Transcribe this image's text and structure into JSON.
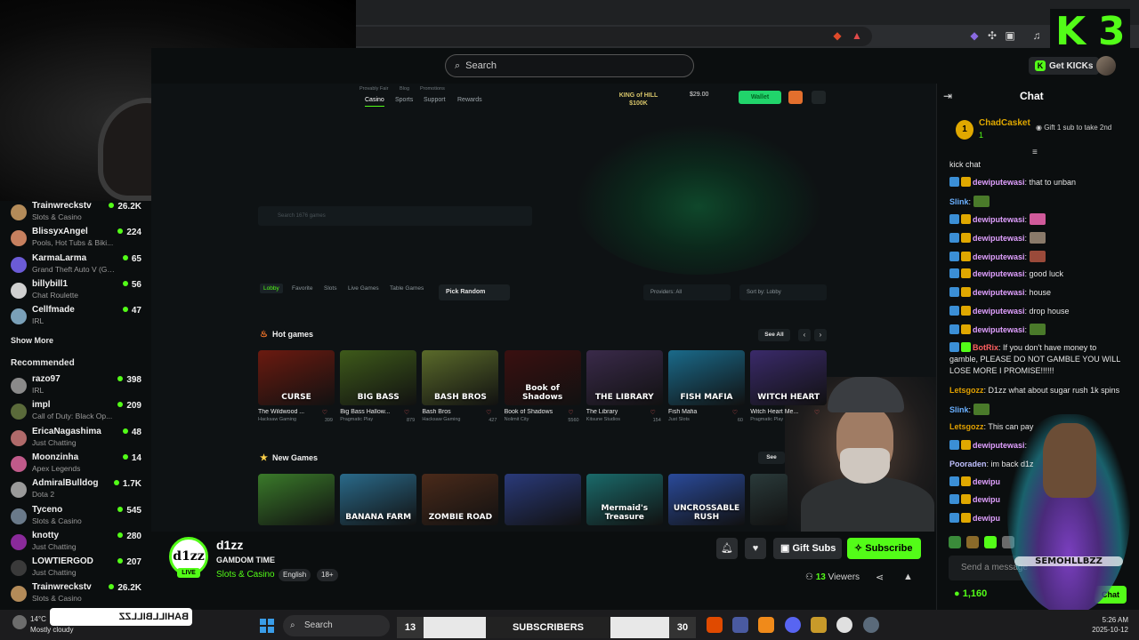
{
  "browser": {
    "search_placeholder": "Search",
    "get_kicks_label": "Get KICKs"
  },
  "overlay": {
    "logo": "K3"
  },
  "sidebar": {
    "following": [
      {
        "name": "Trainwreckstv",
        "category": "Slots & Casino",
        "viewers": "26.2K",
        "color": "#b38b59"
      },
      {
        "name": "BlissyxAngel",
        "category": "Pools, Hot Tubs & Biki...",
        "viewers": "224",
        "color": "#c7805f"
      },
      {
        "name": "KarmaLarma",
        "category": "Grand Theft Auto V (GTA)",
        "viewers": "65",
        "color": "#6b5bd6"
      },
      {
        "name": "billybill1",
        "category": "Chat Roulette",
        "viewers": "56",
        "color": "#d0d0d0"
      },
      {
        "name": "Cellfmade",
        "category": "IRL",
        "viewers": "47",
        "color": "#7aa0b8"
      }
    ],
    "show_more": "Show More",
    "recommended_title": "Recommended",
    "recommended": [
      {
        "name": "razo97",
        "category": "IRL",
        "viewers": "398",
        "color": "#8a8a8a"
      },
      {
        "name": "impl",
        "category": "Call of Duty: Black Op...",
        "viewers": "209",
        "color": "#5a6a3a"
      },
      {
        "name": "EricaNagashima",
        "category": "Just Chatting",
        "viewers": "48",
        "color": "#b06a6a"
      },
      {
        "name": "Moonzinha",
        "category": "Apex Legends",
        "viewers": "14",
        "color": "#c05a8a"
      },
      {
        "name": "AdmiralBulldog",
        "category": "Dota 2",
        "viewers": "1.7K",
        "color": "#9a9a9a"
      },
      {
        "name": "Tyceno",
        "category": "Slots & Casino",
        "viewers": "545",
        "color": "#6a7a8a"
      },
      {
        "name": "knotty",
        "category": "Just Chatting",
        "viewers": "280",
        "color": "#8a2a9a"
      },
      {
        "name": "LOWTIERGOD",
        "category": "Just Chatting",
        "viewers": "207",
        "color": "#3a3a3a"
      },
      {
        "name": "Trainwreckstv",
        "category": "Slots & Casino",
        "viewers": "26.2K",
        "color": "#b38b59"
      }
    ]
  },
  "gamdom": {
    "nav_small": [
      "Provably Fair",
      "Blog",
      "Promotions"
    ],
    "nav": [
      "Casino",
      "Sports",
      "Support",
      "Rewards"
    ],
    "king_hill": "KING of HILL",
    "king_prize": "$100K",
    "balance": "$29.00",
    "wallet": "Wallet",
    "game_search_placeholder": "Search 1676 games",
    "tabs": [
      "Lobby",
      "Favorite",
      "Slots",
      "Live Games",
      "Table Games"
    ],
    "pick_random": "Pick Random",
    "providers": "Providers: All",
    "sort_by": "Sort by: Lobby",
    "hot_games_title": "Hot games",
    "see_all": "See All",
    "new_games_title": "New Games",
    "see": "See",
    "hot_games": [
      {
        "title": "The Wildwood ...",
        "provider": "Hacksaw Gaming",
        "count": "399",
        "art": "CURSE",
        "bg": "#6b1a10"
      },
      {
        "title": "Big Bass Hallow...",
        "provider": "Pragmatic Play",
        "count": "879",
        "art": "BIG BASS",
        "bg": "#3e5a1a"
      },
      {
        "title": "Bash Bros",
        "provider": "Hacksaw Gaming",
        "count": "427",
        "art": "BASH BROS",
        "bg": "#5a6a2a"
      },
      {
        "title": "Book of Shadows",
        "provider": "Nolimit City",
        "count": "5560",
        "art": "Book of Shadows",
        "bg": "#3a1010"
      },
      {
        "title": "The Library",
        "provider": "Kitsune Studios",
        "count": "154",
        "art": "THE LIBRARY",
        "bg": "#3a2a4a"
      },
      {
        "title": "Fish Mafia",
        "provider": "Just Slots",
        "count": "60",
        "art": "FISH MAFIA",
        "bg": "#1a6a8a"
      },
      {
        "title": "Witch Heart Me...",
        "provider": "Pragmatic Play",
        "count": "",
        "art": "WITCH HEART",
        "bg": "#3a2a6a"
      }
    ],
    "new_games": [
      {
        "art": "",
        "bg": "#3a7a2a"
      },
      {
        "art": "BANANA FARM",
        "bg": "#2a6a8a"
      },
      {
        "art": "ZOMBIE ROAD",
        "bg": "#4a2a1a"
      },
      {
        "art": "",
        "bg": "#2a3a7a"
      },
      {
        "art": "Mermaid's Treasure",
        "bg": "#1a6a6a"
      },
      {
        "art": "UNCROSSABLE RUSH",
        "bg": "#2a4a9a"
      },
      {
        "art": "",
        "bg": "#2a3a3a"
      }
    ]
  },
  "stream": {
    "avatar_text": "d1zz",
    "live": "LIVE",
    "name": "d1zz",
    "title": "GAMDOM TIME",
    "category": "Slots & Casino",
    "tags": [
      "English",
      "18+"
    ],
    "gift_subs": "Gift Subs",
    "subscribe": "Subscribe",
    "viewers_count": "13",
    "viewers_label": "Viewers"
  },
  "chat": {
    "title": "Chat",
    "pinned": {
      "rank": "1",
      "user": "ChadCasket",
      "sub": "1",
      "gift_text": "Gift 1 sub to take 2nd"
    },
    "messages": [
      {
        "user": "",
        "text": "kick chat",
        "color": "#e6e6e6",
        "badges": []
      },
      {
        "user": "dewiputewasi",
        "text": ": that to unban",
        "color": "#e0a0ff",
        "badges": [
          "b1",
          "b2"
        ]
      },
      {
        "user": "Slink",
        "text": ":",
        "color": "#6ab0ff",
        "badges": [],
        "emote": "#4a7a2a"
      },
      {
        "user": "dewiputewasi",
        "text": ":",
        "color": "#e0a0ff",
        "badges": [
          "b1",
          "b2"
        ],
        "emote": "#d05a9a"
      },
      {
        "user": "dewiputewasi",
        "text": ":",
        "color": "#e0a0ff",
        "badges": [
          "b1",
          "b2"
        ],
        "emote": "#8a7a6a"
      },
      {
        "user": "dewiputewasi",
        "text": ":",
        "color": "#e0a0ff",
        "badges": [
          "b1",
          "b2"
        ],
        "emote": "#9a4a3a"
      },
      {
        "user": "dewiputewasi",
        "text": ": good luck",
        "color": "#e0a0ff",
        "badges": [
          "b1",
          "b2"
        ]
      },
      {
        "user": "dewiputewasi",
        "text": ": house",
        "color": "#e0a0ff",
        "badges": [
          "b1",
          "b2"
        ]
      },
      {
        "user": "dewiputewasi",
        "text": ": drop house",
        "color": "#e0a0ff",
        "badges": [
          "b1",
          "b2"
        ]
      },
      {
        "user": "dewiputewasi",
        "text": ":",
        "color": "#e0a0ff",
        "badges": [
          "b1",
          "b2"
        ],
        "emote": "#4a7a2a"
      },
      {
        "user": "BotRix",
        "text": ": If you don't have money to gamble, PLEASE DO NOT GAMBLE YOU WILL LOSE MORE I PROMISE!!!!!!",
        "color": "#ff6060",
        "badges": [
          "b1",
          "b3"
        ]
      },
      {
        "user": "Letsgozz",
        "text": ": D1zz what about sugar rush 1k spins",
        "color": "#e0a000",
        "badges": []
      },
      {
        "user": "Slink",
        "text": ":",
        "color": "#6ab0ff",
        "badges": [],
        "emote": "#4a7a2a"
      },
      {
        "user": "Letsgozz",
        "text": ": This can pay",
        "color": "#e0a000",
        "badges": []
      },
      {
        "user": "dewiputewasi",
        "text": ":",
        "color": "#e0a0ff",
        "badges": [
          "b1",
          "b2"
        ]
      },
      {
        "user": "Pooraden",
        "text": ": im back d1z",
        "color": "#c0c0ff",
        "badges": []
      },
      {
        "user": "dewipu",
        "text": "",
        "color": "#e0a0ff",
        "badges": [
          "b1",
          "b2"
        ]
      },
      {
        "user": "dewipu",
        "text": "",
        "color": "#e0a0ff",
        "badges": [
          "b1",
          "b2"
        ]
      },
      {
        "user": "dewipu",
        "text": "",
        "color": "#e0a0ff",
        "badges": [
          "b1",
          "b2"
        ]
      }
    ],
    "input_placeholder": "Send a message",
    "kicks": "1,160",
    "send": "Chat",
    "overlay_text": "SEMOHLLBZZ"
  },
  "taskbar": {
    "temp": "14°C",
    "weather": "Mostly cloudy",
    "overlay_name": "BAHILLBILLZZ",
    "search": "Search",
    "subs_left": "13",
    "subs_label": "SUBSCRIBERS",
    "subs_right": "30",
    "time": "5:26 AM",
    "date": "2025-10-12"
  }
}
